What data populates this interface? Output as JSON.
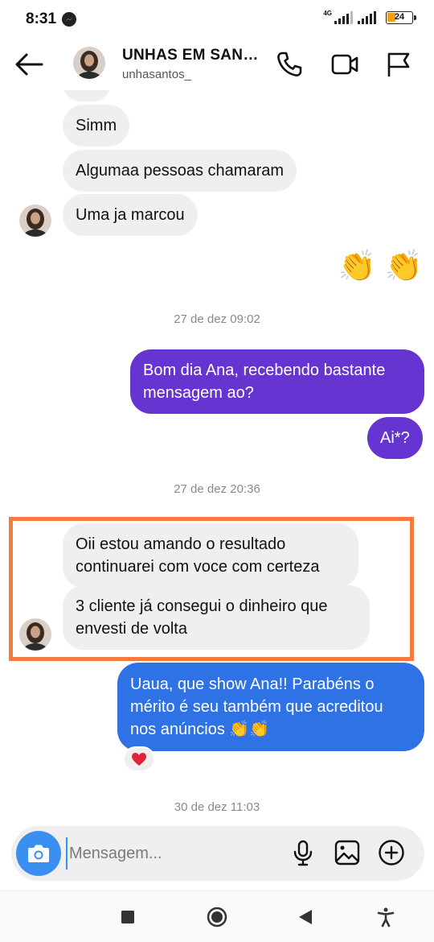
{
  "status_bar": {
    "time": "8:31",
    "network_label": "4G",
    "battery_level": "24",
    "icons": [
      "messenger-icon",
      "signal-icon",
      "battery-icon"
    ]
  },
  "header": {
    "contact_name": "UNHAS EM SAN…",
    "username": "unhasantos_",
    "icons": [
      "back-arrow-icon",
      "phone-icon",
      "video-camera-icon",
      "flag-icon"
    ]
  },
  "chat": {
    "messages": [
      {
        "direction": "incoming",
        "text": "Simm"
      },
      {
        "direction": "incoming",
        "text": "Algumaa pessoas chamaram"
      },
      {
        "direction": "incoming",
        "text": "Uma ja marcou"
      },
      {
        "direction": "outgoing",
        "text": "👏 👏"
      },
      {
        "type": "timestamp",
        "text": "27 de dez 09:02"
      },
      {
        "direction": "outgoing",
        "line1": "Bom dia Ana, recebendo bastante",
        "line2": "mensagem ao?"
      },
      {
        "direction": "outgoing",
        "text": "Ai*?"
      },
      {
        "type": "timestamp",
        "text": "27 de dez 20:36"
      },
      {
        "direction": "incoming",
        "line1": "Oii estou amando o resultado",
        "line2": "continuarei com voce com certeza"
      },
      {
        "direction": "incoming",
        "line1": "3 cliente já consegui o dinheiro que",
        "line2": "envesti de volta"
      },
      {
        "direction": "outgoing",
        "line1": "Uaua, que show Ana!! Parabéns o",
        "line2": "mérito é seu também que acreditou",
        "line3": "nos anúncios 👏👏"
      },
      {
        "type": "timestamp",
        "text": "30 de dez 11:03"
      }
    ],
    "reaction": "heart-icon",
    "highlight_color": "#f47a3e",
    "colors": {
      "incoming": "#efefef",
      "outgoing_purple": "#6634d0",
      "outgoing_blue": "#2f72e6"
    }
  },
  "composer": {
    "placeholder": "Mensagem...",
    "icons": [
      "camera-icon",
      "microphone-icon",
      "gallery-icon",
      "plus-icon"
    ],
    "camera_color": "#3a8ff0"
  },
  "navbar": {
    "icons": [
      "recents-square-icon",
      "home-circle-icon",
      "back-triangle-icon",
      "accessibility-icon"
    ]
  }
}
